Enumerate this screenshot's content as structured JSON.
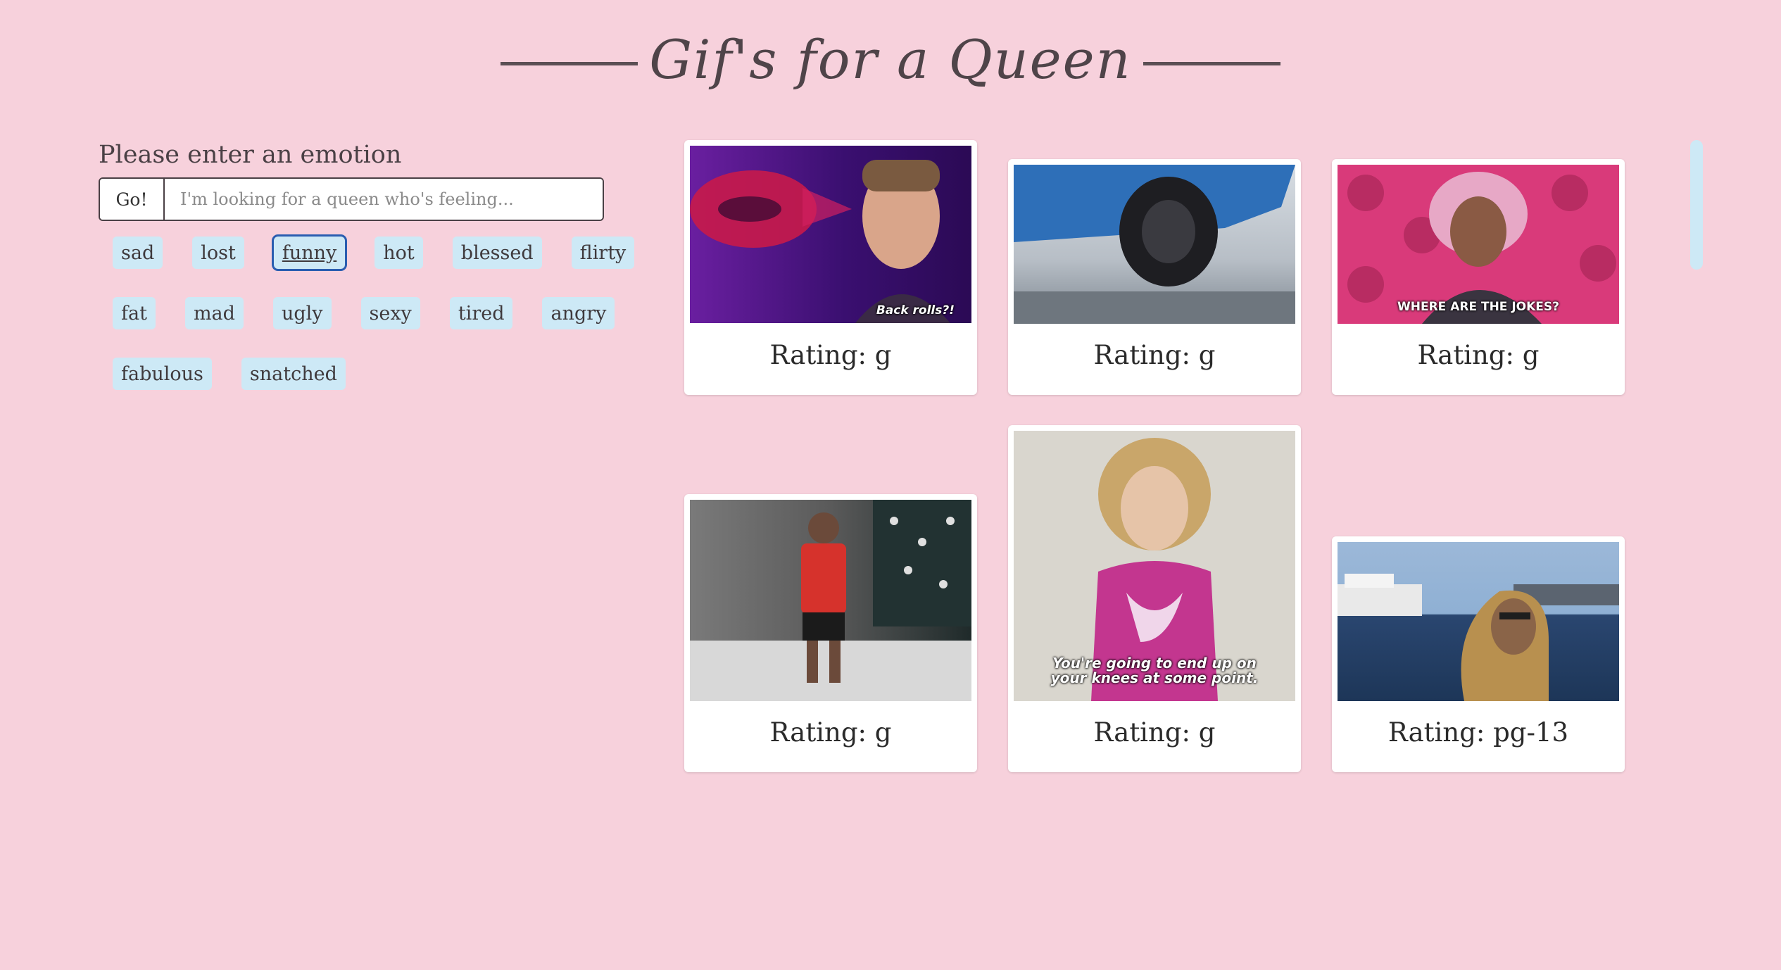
{
  "header": {
    "title": "Gif's for a Queen"
  },
  "search": {
    "prompt": "Please enter an emotion",
    "go_label": "Go!",
    "placeholder": "I'm looking for a queen who's feeling..."
  },
  "tags": [
    [
      "sad",
      "lost",
      "funny",
      "hot",
      "blessed",
      "flirty"
    ],
    [
      "fat",
      "mad",
      "ugly",
      "sexy",
      "tired",
      "angry"
    ],
    [
      "fabulous",
      "snatched"
    ]
  ],
  "focused_tag": "funny",
  "cards": [
    {
      "caption": "Back rolls?!",
      "rating": "Rating: g"
    },
    {
      "caption": "",
      "rating": "Rating: g"
    },
    {
      "caption": "WHERE ARE THE JOKES?",
      "rating": "Rating: g"
    },
    {
      "caption": "",
      "rating": "Rating: g"
    },
    {
      "caption": "You're going to end up on your knees at some point.",
      "rating": "Rating: g"
    },
    {
      "caption": "",
      "rating": "Rating: pg-13"
    }
  ],
  "colors": {
    "background": "#f7d1dc",
    "tag": "#cde9f6",
    "focus": "#2a5db0"
  }
}
